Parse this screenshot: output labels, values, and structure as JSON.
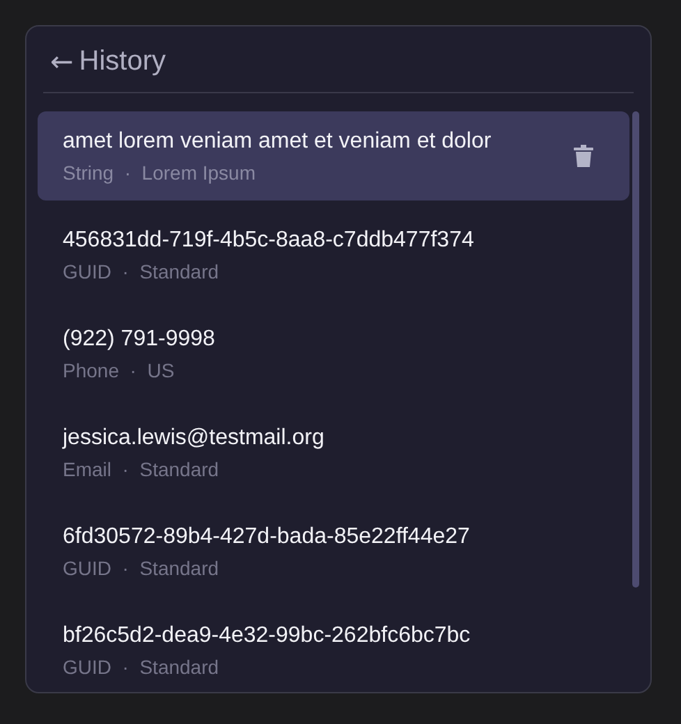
{
  "header": {
    "back": "←",
    "title": "History"
  },
  "items": [
    {
      "value": "amet lorem veniam amet et veniam et dolor",
      "meta": "String  ·  Lorem Ipsum",
      "selected": true
    },
    {
      "value": "456831dd-719f-4b5c-8aa8-c7ddb477f374",
      "meta": "GUID  ·  Standard",
      "selected": false
    },
    {
      "value": "(922) 791-9998",
      "meta": "Phone  ·  US",
      "selected": false
    },
    {
      "value": "jessica.lewis@testmail.org",
      "meta": "Email  ·  Standard",
      "selected": false
    },
    {
      "value": "6fd30572-89b4-427d-bada-85e22ff44e27",
      "meta": "GUID  ·  Standard",
      "selected": false
    },
    {
      "value": "bf26c5d2-dea9-4e32-99bc-262bfc6bc7bc",
      "meta": "GUID  ·  Standard",
      "selected": false
    }
  ]
}
